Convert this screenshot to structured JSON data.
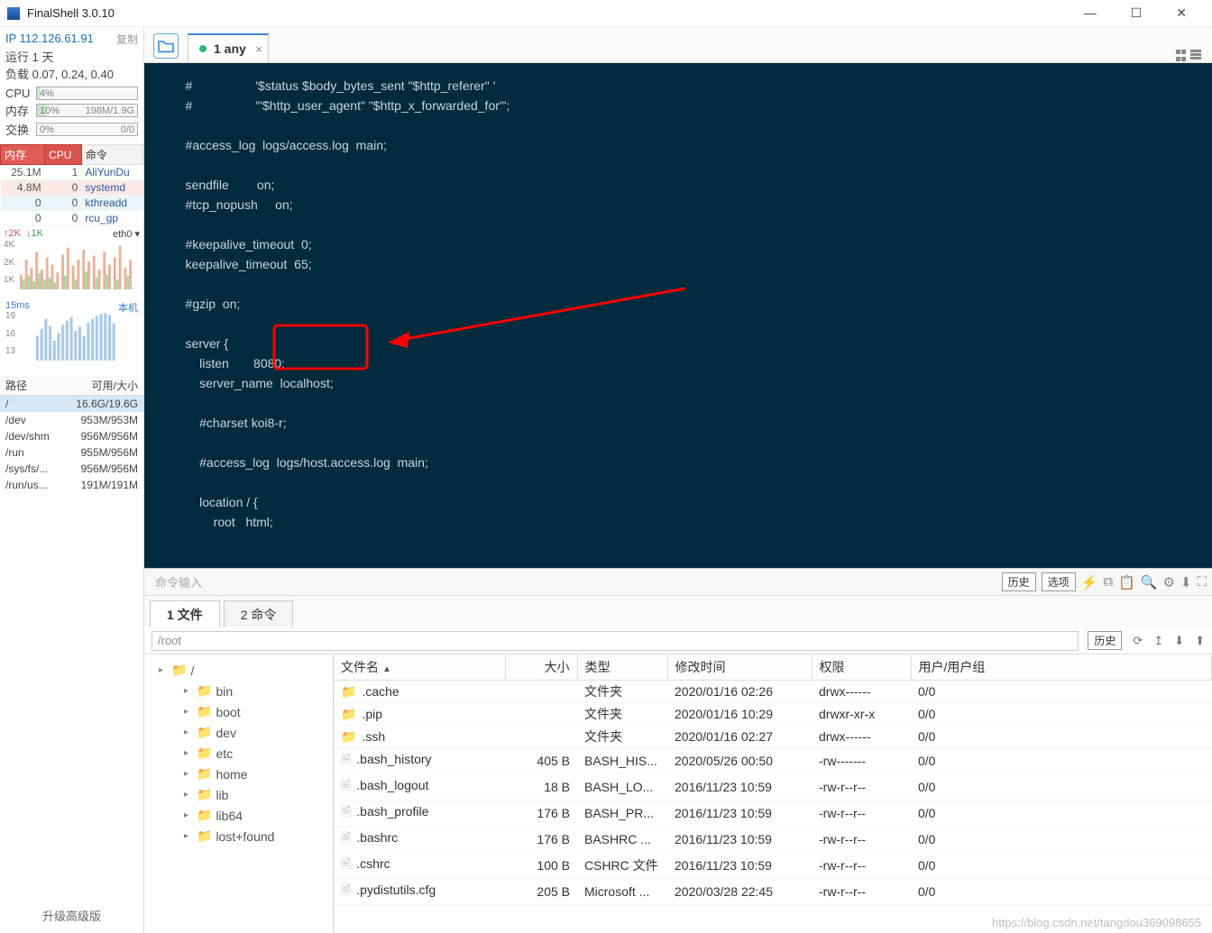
{
  "window": {
    "title": "FinalShell 3.0.10"
  },
  "sidebar": {
    "ip": "IP 112.126.61.91",
    "copy_label": "复制",
    "uptime": "运行 1 天",
    "load_label": "负载 0.07, 0.24, 0.40",
    "cpu": {
      "label": "CPU",
      "value": "4%",
      "pct": 4
    },
    "mem": {
      "label": "内存",
      "value": "10%",
      "pct": 10,
      "detail": "198M/1.9G"
    },
    "swap": {
      "label": "交换",
      "value": "0%",
      "pct": 0,
      "detail": "0/0"
    },
    "proc": {
      "headers": [
        "内存",
        "CPU",
        "命令"
      ],
      "rows": [
        [
          "25.1M",
          "1",
          "AliYunDu"
        ],
        [
          "4.8M",
          "0",
          "systemd"
        ],
        [
          "0",
          "0",
          "kthreadd"
        ],
        [
          "0",
          "0",
          "rcu_gp"
        ]
      ]
    },
    "net": {
      "up_label": "2K",
      "down_label": "1K",
      "iface": "eth0 ▾",
      "y_labels": [
        "4K",
        "2K",
        "1K"
      ]
    },
    "latency": {
      "value": "15ms",
      "host": "本机",
      "y_labels": [
        "19",
        "16",
        "13"
      ]
    },
    "disk": {
      "headers": [
        "路径",
        "可用/大小"
      ],
      "rows": [
        [
          "/",
          "16.6G/19.6G"
        ],
        [
          "/dev",
          "953M/953M"
        ],
        [
          "/dev/shm",
          "956M/956M"
        ],
        [
          "/run",
          "955M/956M"
        ],
        [
          "/sys/fs/...",
          "956M/956M"
        ],
        [
          "/run/us...",
          "191M/191M"
        ]
      ]
    },
    "upgrade": "升级高级版"
  },
  "tabs": {
    "tab1": "1 any"
  },
  "terminal_lines": [
    "    #                  '$status $body_bytes_sent \"$http_referer\" '",
    "    #                  '\"$http_user_agent\" \"$http_x_forwarded_for\"';",
    "",
    "    #access_log  logs/access.log  main;",
    "",
    "    sendfile        on;",
    "    #tcp_nopush     on;",
    "",
    "    #keepalive_timeout  0;",
    "    keepalive_timeout  65;",
    "",
    "    #gzip  on;",
    "",
    "    server {",
    "        listen       8080;",
    "        server_name  localhost;",
    "",
    "        #charset koi8-r;",
    "",
    "        #access_log  logs/host.access.log  main;",
    "",
    "        location / {",
    "            root   html;"
  ],
  "cmd_input": {
    "placeholder": "命令输入",
    "history": "历史",
    "options": "选项"
  },
  "bottom_tabs": {
    "files": "1 文件",
    "cmds": "2 命令"
  },
  "pathbar": {
    "path": "/root",
    "history": "历史"
  },
  "tree": [
    "/",
    "bin",
    "boot",
    "dev",
    "etc",
    "home",
    "lib",
    "lib64",
    "lost+found"
  ],
  "file_headers": [
    "文件名",
    "大小",
    "类型",
    "修改时间",
    "权限",
    "用户/用户组"
  ],
  "file_rows": [
    {
      "name": ".cache",
      "size": "",
      "type": "文件夹",
      "mtime": "2020/01/16 02:26",
      "perm": "drwx------",
      "owner": "0/0",
      "folder": true
    },
    {
      "name": ".pip",
      "size": "",
      "type": "文件夹",
      "mtime": "2020/01/16 10:29",
      "perm": "drwxr-xr-x",
      "owner": "0/0",
      "folder": true
    },
    {
      "name": ".ssh",
      "size": "",
      "type": "文件夹",
      "mtime": "2020/01/16 02:27",
      "perm": "drwx------",
      "owner": "0/0",
      "folder": true
    },
    {
      "name": ".bash_history",
      "size": "405 B",
      "type": "BASH_HIS...",
      "mtime": "2020/05/26 00:50",
      "perm": "-rw-------",
      "owner": "0/0",
      "folder": false
    },
    {
      "name": ".bash_logout",
      "size": "18 B",
      "type": "BASH_LO...",
      "mtime": "2016/11/23 10:59",
      "perm": "-rw-r--r--",
      "owner": "0/0",
      "folder": false
    },
    {
      "name": ".bash_profile",
      "size": "176 B",
      "type": "BASH_PR...",
      "mtime": "2016/11/23 10:59",
      "perm": "-rw-r--r--",
      "owner": "0/0",
      "folder": false
    },
    {
      "name": ".bashrc",
      "size": "176 B",
      "type": "BASHRC ...",
      "mtime": "2016/11/23 10:59",
      "perm": "-rw-r--r--",
      "owner": "0/0",
      "folder": false
    },
    {
      "name": ".cshrc",
      "size": "100 B",
      "type": "CSHRC 文件",
      "mtime": "2016/11/23 10:59",
      "perm": "-rw-r--r--",
      "owner": "0/0",
      "folder": false
    },
    {
      "name": ".pydistutils.cfg",
      "size": "205 B",
      "type": "Microsoft ...",
      "mtime": "2020/03/28 22:45",
      "perm": "-rw-r--r--",
      "owner": "0/0",
      "folder": false
    }
  ],
  "watermark": "https://blog.csdn.net/tangdou369098655"
}
